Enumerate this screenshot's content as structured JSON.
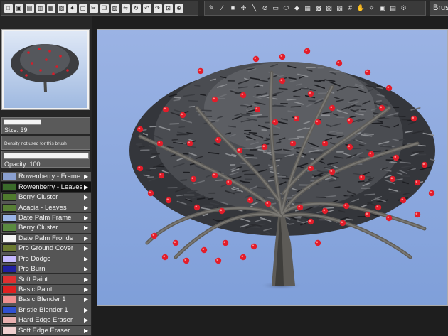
{
  "toolbar": {
    "file_tools": [
      "new-icon",
      "open-icon",
      "save-icon",
      "print-icon",
      "export-icon",
      "import-icon",
      "wand-icon",
      "document-icon",
      "cut-icon",
      "copy-icon",
      "paste-icon",
      "flip-icon",
      "rotate-icon",
      "undo-icon",
      "redo-icon",
      "fit-icon",
      "zoom-icon"
    ],
    "paint_tools": [
      "brush-icon",
      "picker-icon",
      "square-icon",
      "move-icon",
      "line-icon",
      "fill-icon",
      "rectangle-icon",
      "ellipse-icon",
      "lasso-icon",
      "layer-icon",
      "checker-icon",
      "mask-icon",
      "pattern-icon",
      "grid-icon",
      "smudge-icon",
      "magic-icon",
      "image-icon",
      "dock-icon",
      "settings-icon"
    ],
    "menu_label": "Brush"
  },
  "panel": {
    "size_label": "Size: 39",
    "density_label": "Density not used for this brush",
    "opacity_label": "Opacity: 100"
  },
  "brushes": [
    {
      "label": "Rowenberry - Frame",
      "swatch": "#8aa0d0",
      "selected": false
    },
    {
      "label": "Rowenberry - Leaves",
      "swatch": "#3a6a2a",
      "selected": true
    },
    {
      "label": "Berry Cluster",
      "swatch": "#4f7a2e",
      "selected": false
    },
    {
      "label": "Acacia - Leaves",
      "swatch": "#587f35",
      "selected": false
    },
    {
      "label": "Date Palm Frame",
      "swatch": "#9ab4e6",
      "selected": false
    },
    {
      "label": "Berry Cluster",
      "swatch": "#5a8a40",
      "selected": false
    },
    {
      "label": "Date Palm Fronds",
      "swatch": "#f4f4f4",
      "selected": false
    },
    {
      "label": "Pro Ground Cover",
      "swatch": "#6b7a30",
      "selected": false
    },
    {
      "label": "Pro Dodge",
      "swatch": "#c4b8ff",
      "selected": false
    },
    {
      "label": "Pro Burn",
      "swatch": "#2020a0",
      "selected": false
    },
    {
      "label": "Soft Paint",
      "swatch": "#e03030",
      "selected": false
    },
    {
      "label": "Basic Paint",
      "swatch": "#e02020",
      "selected": false
    },
    {
      "label": "Basic Blender 1",
      "swatch": "#f09090",
      "selected": false
    },
    {
      "label": "Bristle Blender 1",
      "swatch": "#3050d0",
      "selected": false
    },
    {
      "label": "Hard Edge Eraser",
      "swatch": "#e8b0b0",
      "selected": false
    },
    {
      "label": "Soft Edge Eraser",
      "swatch": "#f0d0d0",
      "selected": false
    }
  ],
  "colors": {
    "sky_top": "#9bb3e4",
    "sky_bottom": "#7f9fd9",
    "berry": "#e21d2a",
    "trunk": "#5d5b57"
  }
}
